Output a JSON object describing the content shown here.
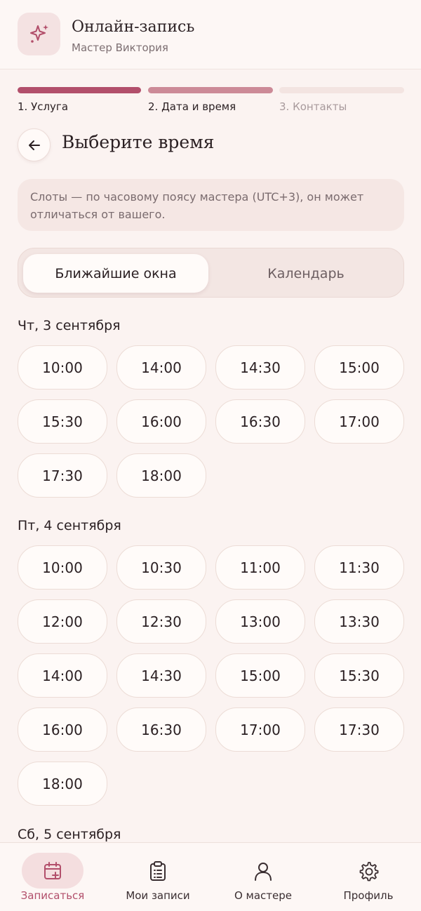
{
  "header": {
    "title": "Онлайн-запись",
    "subtitle": "Мастер Виктория",
    "logo_icon": "sparkles-icon"
  },
  "steps": [
    {
      "label": "1. Услуга",
      "state": "done"
    },
    {
      "label": "2. Дата и время",
      "state": "current"
    },
    {
      "label": "3. Контакты",
      "state": "upcoming"
    }
  ],
  "page": {
    "title": "Выберите время",
    "back_icon": "arrow-left-icon"
  },
  "note": "Слоты — по часовому поясу мастера (UTC+3), он может отличаться от вашего.",
  "view_toggle": {
    "nearest": "Ближайшие окна",
    "calendar": "Календарь",
    "selected": "nearest"
  },
  "days": [
    {
      "title": "Чт, 3 сентября",
      "slots": [
        "10:00",
        "14:00",
        "14:30",
        "15:00",
        "15:30",
        "16:00",
        "16:30",
        "17:00",
        "17:30",
        "18:00"
      ]
    },
    {
      "title": "Пт, 4 сентября",
      "slots": [
        "10:00",
        "10:30",
        "11:00",
        "11:30",
        "12:00",
        "12:30",
        "13:00",
        "13:30",
        "14:00",
        "14:30",
        "15:00",
        "15:30",
        "16:00",
        "16:30",
        "17:00",
        "17:30",
        "18:00"
      ]
    },
    {
      "title": "Сб, 5 сентября",
      "slots": []
    }
  ],
  "nav": [
    {
      "label": "Записаться",
      "icon": "calendar-plus-icon",
      "active": true
    },
    {
      "label": "Мои записи",
      "icon": "clipboard-list-icon",
      "active": false
    },
    {
      "label": "О мастере",
      "icon": "user-icon",
      "active": false
    },
    {
      "label": "Профиль",
      "icon": "gear-icon",
      "active": false
    }
  ],
  "colors": {
    "accent": "#b24f6b",
    "background": "#fbf3f1"
  }
}
